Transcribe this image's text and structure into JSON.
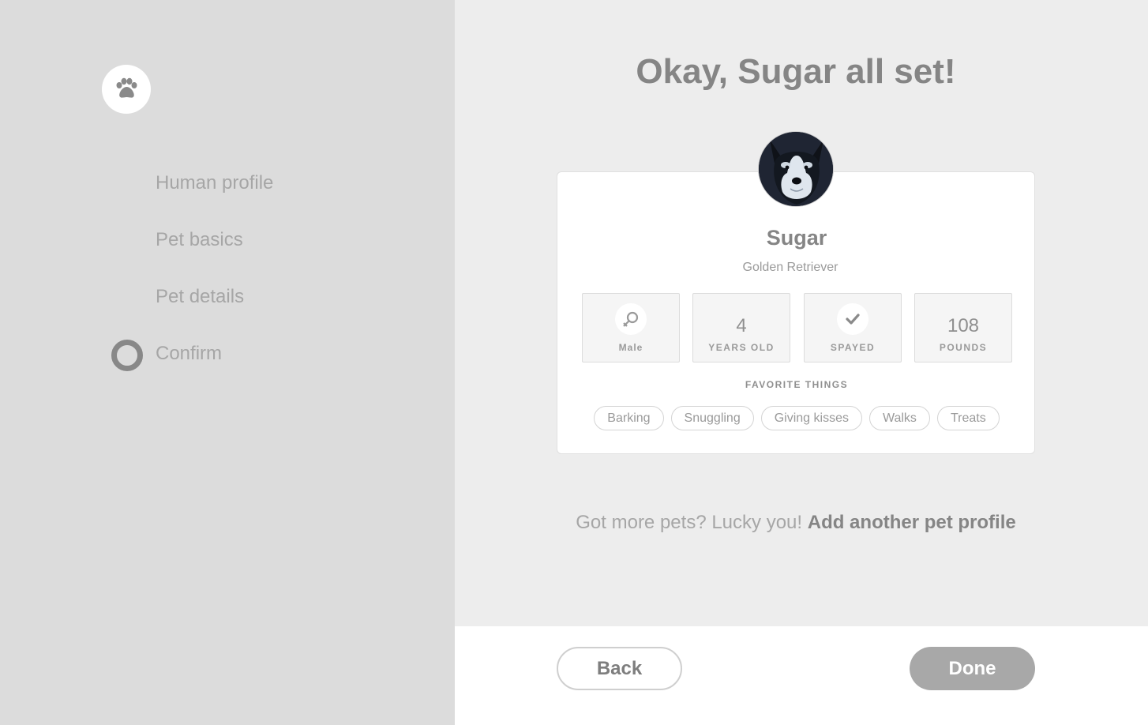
{
  "sidebar": {
    "logo_icon": "paw-icon",
    "steps": [
      {
        "label": "Human profile"
      },
      {
        "label": "Pet basics"
      },
      {
        "label": "Pet details"
      },
      {
        "label": "Confirm",
        "current": true
      }
    ]
  },
  "main": {
    "title": "Okay, Sugar all set!",
    "pet": {
      "name": "Sugar",
      "breed": "Golden Retriever",
      "stats": {
        "gender": {
          "icon": "male-symbol-icon",
          "label": "Male"
        },
        "age": {
          "value": "4",
          "label": "YEARS OLD"
        },
        "spayed": {
          "icon": "check-icon",
          "label": "SPAYED"
        },
        "weight": {
          "value": "108",
          "label": "POUNDS"
        }
      },
      "favorites_title": "FAVORITE THINGS",
      "favorites": [
        "Barking",
        "Snuggling",
        "Giving kisses",
        "Walks",
        "Treats"
      ]
    },
    "more_pets": {
      "prompt": "Got more pets? Lucky you!",
      "link": "Add another pet profile"
    }
  },
  "footer": {
    "back_label": "Back",
    "done_label": "Done"
  },
  "colors": {
    "sidebar_bg": "#dcdcdc",
    "main_bg": "#ededed",
    "done_button": "#a8a8a8"
  }
}
